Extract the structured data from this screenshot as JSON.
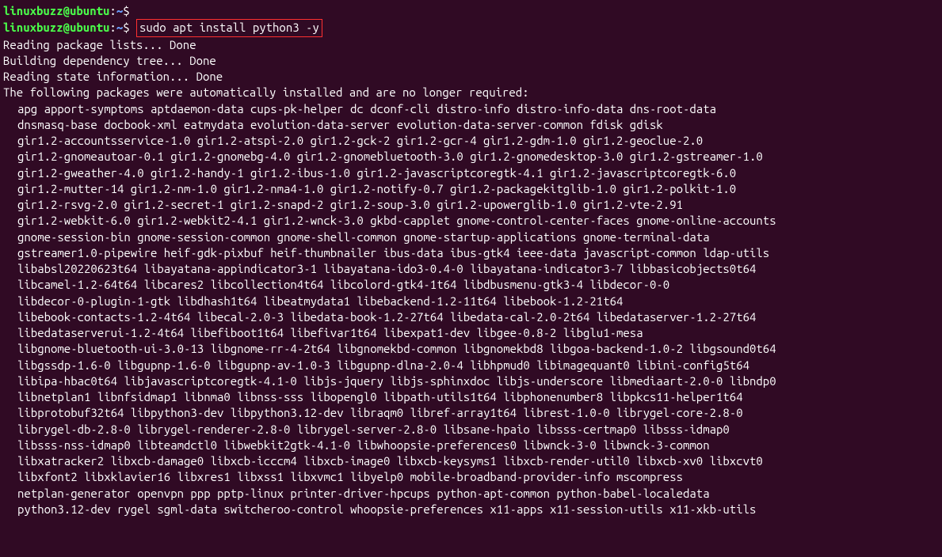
{
  "prompt": {
    "user": "linuxbuzz@ubuntu",
    "sep": ":",
    "path": "~",
    "symbol": "$"
  },
  "command": "sudo apt install python3 -y",
  "output": {
    "reading_lists": "Reading package lists... Done",
    "building_tree": "Building dependency tree... Done",
    "reading_state": "Reading state information... Done",
    "following_msg": "The following packages were automatically installed and are no longer required:",
    "pkg_lines": [
      "apg apport-symptoms aptdaemon-data cups-pk-helper dc dconf-cli distro-info distro-info-data dns-root-data",
      "dnsmasq-base docbook-xml eatmydata evolution-data-server evolution-data-server-common fdisk gdisk",
      "gir1.2-accountsservice-1.0 gir1.2-atspi-2.0 gir1.2-gck-2 gir1.2-gcr-4 gir1.2-gdm-1.0 gir1.2-geoclue-2.0",
      "gir1.2-gnomeautoar-0.1 gir1.2-gnomebg-4.0 gir1.2-gnomebluetooth-3.0 gir1.2-gnomedesktop-3.0 gir1.2-gstreamer-1.0",
      "gir1.2-gweather-4.0 gir1.2-handy-1 gir1.2-ibus-1.0 gir1.2-javascriptcoregtk-4.1 gir1.2-javascriptcoregtk-6.0",
      "gir1.2-mutter-14 gir1.2-nm-1.0 gir1.2-nma4-1.0 gir1.2-notify-0.7 gir1.2-packagekitglib-1.0 gir1.2-polkit-1.0",
      "gir1.2-rsvg-2.0 gir1.2-secret-1 gir1.2-snapd-2 gir1.2-soup-3.0 gir1.2-upowerglib-1.0 gir1.2-vte-2.91",
      "gir1.2-webkit-6.0 gir1.2-webkit2-4.1 gir1.2-wnck-3.0 gkbd-capplet gnome-control-center-faces gnome-online-accounts",
      "gnome-session-bin gnome-session-common gnome-shell-common gnome-startup-applications gnome-terminal-data",
      "gstreamer1.0-pipewire heif-gdk-pixbuf heif-thumbnailer ibus-data ibus-gtk4 ieee-data javascript-common ldap-utils",
      "libabsl20220623t64 libayatana-appindicator3-1 libayatana-ido3-0.4-0 libayatana-indicator3-7 libbasicobjects0t64",
      "libcamel-1.2-64t64 libcares2 libcollection4t64 libcolord-gtk4-1t64 libdbusmenu-gtk3-4 libdecor-0-0",
      "libdecor-0-plugin-1-gtk libdhash1t64 libeatmydata1 libebackend-1.2-11t64 libebook-1.2-21t64",
      "libebook-contacts-1.2-4t64 libecal-2.0-3 libedata-book-1.2-27t64 libedata-cal-2.0-2t64 libedataserver-1.2-27t64",
      "libedataserverui-1.2-4t64 libefiboot1t64 libefivar1t64 libexpat1-dev libgee-0.8-2 libglu1-mesa",
      "libgnome-bluetooth-ui-3.0-13 libgnome-rr-4-2t64 libgnomekbd-common libgnomekbd8 libgoa-backend-1.0-2 libgsound0t64",
      "libgssdp-1.6-0 libgupnp-1.6-0 libgupnp-av-1.0-3 libgupnp-dlna-2.0-4 libhpmud0 libimagequant0 libini-config5t64",
      "libipa-hbac0t64 libjavascriptcoregtk-4.1-0 libjs-jquery libjs-sphinxdoc libjs-underscore libmediaart-2.0-0 libndp0",
      "libnetplan1 libnfsidmap1 libnma0 libnss-sss libopengl0 libpath-utils1t64 libphonenumber8 libpkcs11-helper1t64",
      "libprotobuf32t64 libpython3-dev libpython3.12-dev libraqm0 libref-array1t64 librest-1.0-0 librygel-core-2.8-0",
      "librygel-db-2.8-0 librygel-renderer-2.8-0 librygel-server-2.8-0 libsane-hpaio libsss-certmap0 libsss-idmap0",
      "libsss-nss-idmap0 libteamdctl0 libwebkit2gtk-4.1-0 libwhoopsie-preferences0 libwnck-3-0 libwnck-3-common",
      "libxatracker2 libxcb-damage0 libxcb-icccm4 libxcb-image0 libxcb-keysyms1 libxcb-render-util0 libxcb-xv0 libxcvt0",
      "libxfont2 libxklavier16 libxres1 libxss1 libxvmc1 libyelp0 mobile-broadband-provider-info mscompress",
      "netplan-generator openvpn ppp pptp-linux printer-driver-hpcups python-apt-common python-babel-localedata",
      "python3.12-dev rygel sgml-data switcheroo-control whoopsie-preferences x11-apps x11-session-utils x11-xkb-utils"
    ]
  }
}
